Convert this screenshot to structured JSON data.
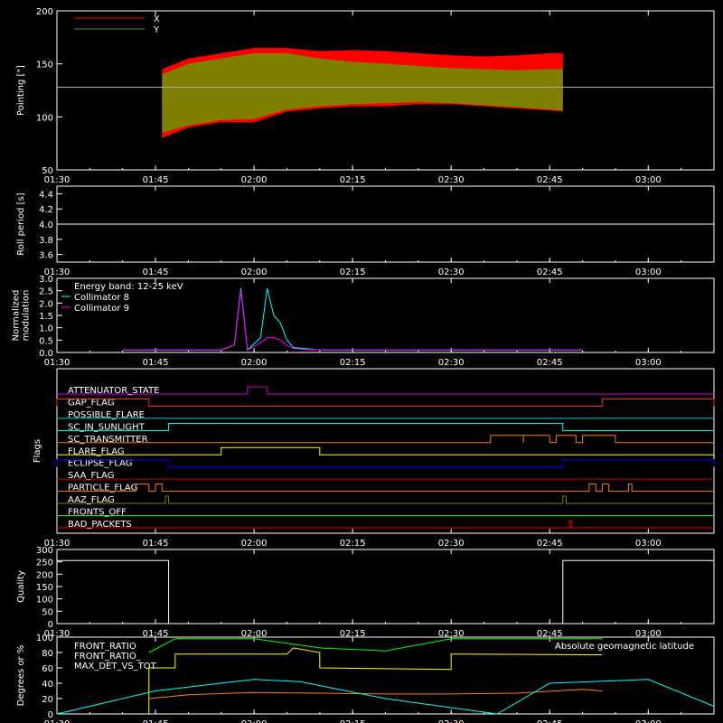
{
  "chart_data": [
    {
      "id": "pointing",
      "type": "area",
      "ylabel": "Pointing [\"]",
      "ylim": [
        50,
        200
      ],
      "yticks": [
        50,
        100,
        150,
        200
      ],
      "reference_line": 128,
      "legend": {
        "placement": "top-left",
        "entries": [
          {
            "label": "X",
            "color": "#ff0000"
          },
          {
            "label": "Y",
            "color": "#808000"
          }
        ]
      },
      "series": [
        {
          "name": "X",
          "color": "#ff0000",
          "x": [
            "01:46",
            "01:50",
            "01:55",
            "02:00",
            "02:05",
            "02:10",
            "02:15",
            "02:20",
            "02:25",
            "02:30",
            "02:35",
            "02:40",
            "02:45",
            "02:47"
          ],
          "upper": [
            145,
            155,
            160,
            165,
            165,
            162,
            163,
            162,
            160,
            158,
            157,
            158,
            160,
            160
          ],
          "lower": [
            80,
            90,
            95,
            95,
            105,
            108,
            110,
            110,
            112,
            112,
            110,
            108,
            106,
            105
          ]
        },
        {
          "name": "Y",
          "color": "#808000",
          "x": [
            "01:46",
            "01:50",
            "01:55",
            "02:00",
            "02:05",
            "02:10",
            "02:15",
            "02:20",
            "02:25",
            "02:30",
            "02:35",
            "02:40",
            "02:45",
            "02:47"
          ],
          "upper": [
            140,
            150,
            155,
            160,
            160,
            155,
            152,
            150,
            148,
            146,
            145,
            144,
            145,
            145
          ],
          "lower": [
            85,
            92,
            97,
            98,
            107,
            110,
            112,
            113,
            114,
            113,
            111,
            109,
            107,
            106
          ]
        }
      ]
    },
    {
      "id": "roll",
      "type": "line",
      "ylabel": "Roll period [s]",
      "ylim": [
        3.5,
        4.5
      ],
      "yticks": [
        3.6,
        3.8,
        4.0,
        4.2,
        4.4
      ],
      "series": [
        {
          "color": "#ffffff",
          "x": [
            "01:30",
            "03:10"
          ],
          "values": [
            4.0,
            4.0
          ]
        }
      ]
    },
    {
      "id": "modulation",
      "type": "line",
      "ylabel": "Normalized modulation",
      "ylim": [
        0,
        3.0
      ],
      "yticks": [
        0.0,
        0.5,
        1.0,
        1.5,
        2.0,
        2.5,
        3.0
      ],
      "annotation": "Energy band: 12-25 keV",
      "series": [
        {
          "name": "Collimator 8",
          "color": "#00ffff",
          "x": [
            "01:40",
            "01:55",
            "01:57",
            "01:58",
            "01:59",
            "02:01",
            "02:02",
            "02:03",
            "02:04",
            "02:05",
            "02:06",
            "02:10",
            "02:50"
          ],
          "values": [
            0.1,
            0.1,
            0.3,
            2.6,
            0.1,
            0.6,
            2.6,
            1.5,
            1.2,
            0.5,
            0.2,
            0.1,
            0.1
          ]
        },
        {
          "name": "Collimator 9",
          "color": "#ff00ff",
          "x": [
            "01:40",
            "01:55",
            "01:57",
            "01:58",
            "01:59",
            "02:01",
            "02:02",
            "02:03",
            "02:04",
            "02:05",
            "02:06",
            "02:10",
            "02:50"
          ],
          "values": [
            0.1,
            0.1,
            0.3,
            2.5,
            0.1,
            0.4,
            0.6,
            0.6,
            0.5,
            0.3,
            0.15,
            0.1,
            0.1
          ]
        }
      ]
    },
    {
      "id": "flags",
      "type": "line",
      "ylabel": "Flags",
      "flags": [
        {
          "label": "ATTENUATOR_STATE",
          "color": "#cc00cc",
          "on": [
            [
              "01:59",
              "02:02"
            ]
          ]
        },
        {
          "label": "GAP_FLAG",
          "color": "#ff2020",
          "on": [
            [
              "01:30",
              "01:44"
            ],
            [
              "02:53",
              "03:10"
            ]
          ]
        },
        {
          "label": "POSSIBLE_FLARE",
          "color": "#00cccc",
          "on": []
        },
        {
          "label": "SC_IN_SUNLIGHT",
          "color": "#00ffff",
          "on": [
            [
              "01:47",
              "02:47"
            ]
          ]
        },
        {
          "label": "SC_TRANSMITTER",
          "color": "#ff8000",
          "on": [
            [
              "02:36",
              "02:41"
            ],
            [
              "02:41",
              "02:45"
            ],
            [
              "02:46",
              "02:49"
            ],
            [
              "02:50",
              "02:55"
            ]
          ]
        },
        {
          "label": "FLARE_FLAG",
          "color": "#ffff00",
          "on": [
            [
              "01:55",
              "02:10"
            ]
          ]
        },
        {
          "label": "ECLIPSE_FLAG",
          "color": "#0000ff",
          "on": [
            [
              "01:30",
              "01:47"
            ],
            [
              "02:47",
              "03:10"
            ]
          ]
        },
        {
          "label": "SAA_FLAG",
          "color": "#cc0000",
          "on": []
        },
        {
          "label": "PARTICLE_FLAG",
          "color": "#ff8000",
          "on": [
            [
              "01:42",
              "01:44"
            ],
            [
              "01:45",
              "01:46"
            ],
            [
              "02:51",
              "02:52"
            ],
            [
              "02:53",
              "02:54"
            ],
            [
              "02:57",
              "02:57.5"
            ]
          ]
        },
        {
          "label": "AAZ_FLAG",
          "color": "#808000",
          "on": [
            [
              "01:46.5",
              "01:47"
            ],
            [
              "02:47",
              "02:47.5"
            ]
          ]
        },
        {
          "label": "FRONTS_OFF",
          "color": "#00ff00",
          "on": []
        },
        {
          "label": "BAD_PACKETS",
          "color": "#ff0000",
          "on": [
            [
              "02:48",
              "02:48.3"
            ]
          ]
        }
      ]
    },
    {
      "id": "quality",
      "type": "line",
      "ylabel": "Quality",
      "ylim": [
        0,
        300
      ],
      "yticks": [
        0,
        50,
        100,
        150,
        200,
        250,
        300
      ],
      "series": [
        {
          "color": "#ffffff",
          "x": [
            "01:30",
            "01:47",
            "01:47",
            "02:47",
            "02:47",
            "03:10"
          ],
          "values": [
            255,
            255,
            0,
            0,
            255,
            255
          ]
        }
      ]
    },
    {
      "id": "front_ratio",
      "type": "line",
      "ylabel": "Degrees or %",
      "ylim": [
        0,
        100
      ],
      "yticks": [
        0,
        20,
        40,
        60,
        80,
        100
      ],
      "legend": {
        "placement": "top-left"
      },
      "annotation": "Absolute geomagnetic latitude",
      "series": [
        {
          "name": "FRONT_RATIO",
          "color": "#ffff00",
          "x": [
            "01:44",
            "01:44",
            "01:48",
            "01:48",
            "02:05",
            "02:06",
            "02:10",
            "02:10",
            "02:30",
            "02:30",
            "02:53"
          ],
          "values": [
            0,
            60,
            60,
            78,
            78,
            86,
            80,
            60,
            58,
            78,
            77
          ]
        },
        {
          "name": "FRONT_RATIO_",
          "color": "#00ff00",
          "x": [
            "01:44",
            "01:48",
            "02:00",
            "02:10",
            "02:20",
            "02:30",
            "02:40",
            "02:53"
          ],
          "values": [
            80,
            98,
            98,
            86,
            82,
            98,
            98,
            98
          ]
        },
        {
          "name": "MAX_DET_VS_TOT",
          "color": "#ff8000",
          "x": [
            "01:44",
            "01:50",
            "02:00",
            "02:10",
            "02:20",
            "02:30",
            "02:40",
            "02:50",
            "02:53"
          ],
          "values": [
            20,
            25,
            28,
            27,
            26,
            26,
            27,
            32,
            30
          ]
        },
        {
          "name": "Absolute geomagnetic latitude",
          "color": "#00ffff",
          "x": [
            "01:30",
            "01:45",
            "02:00",
            "02:07",
            "02:20",
            "02:37",
            "02:45",
            "03:00",
            "03:10"
          ],
          "values": [
            0,
            30,
            45,
            42,
            20,
            0,
            40,
            45,
            10
          ]
        }
      ]
    }
  ],
  "x_axis": {
    "xlim": [
      "01:30",
      "03:10"
    ],
    "ticks": [
      "01:30",
      "01:45",
      "02:00",
      "02:15",
      "02:30",
      "02:45",
      "03:00"
    ]
  }
}
